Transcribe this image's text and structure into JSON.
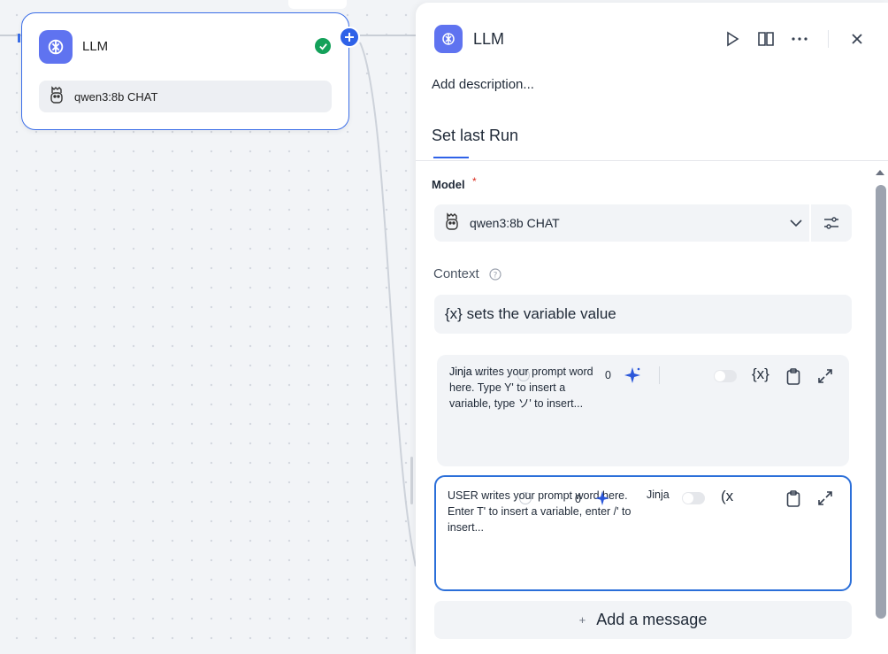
{
  "node": {
    "title": "LLM",
    "model_label": "qwen3:8b CHAT"
  },
  "panel": {
    "title": "LLM",
    "description": "Add description...",
    "tab": "Set last Run",
    "model": {
      "label": "Model",
      "required_mark": "*",
      "value": "qwen3:8b CHAT"
    },
    "context": {
      "label": "Context",
      "value": "{x} sets the variable value"
    },
    "system_prompt": {
      "role_label": "Jinja ...",
      "placeholder": "Jinja writes your prompt word here. Type Y' to insert a variable, type ソ' to insert...",
      "count": "0",
      "var_button": "{x}"
    },
    "user_prompt": {
      "placeholder": "USER writes your prompt word here. Enter T' to insert a variable, enter /' to insert...",
      "count": "0",
      "jinja_label": "Jinja",
      "var_button": "(x"
    },
    "add_message": "Add a message",
    "add_message_plus": "+"
  },
  "colors": {
    "accent": "#2f62e8",
    "icon_bg": "#5f73f0",
    "success": "#14a15a",
    "required": "#d92d20",
    "spark": "#2b57d9"
  },
  "icons": {
    "node": "llm-brain-icon",
    "model": "llama-icon",
    "status": "check-icon",
    "run": "play-icon",
    "docs": "book-icon",
    "more": "more-icon",
    "close": "close-icon",
    "chevron": "chevron-down-icon",
    "settings": "sliders-icon",
    "help": "help-icon",
    "spark": "sparkle-icon",
    "copy": "clipboard-icon",
    "expand": "expand-icon"
  }
}
